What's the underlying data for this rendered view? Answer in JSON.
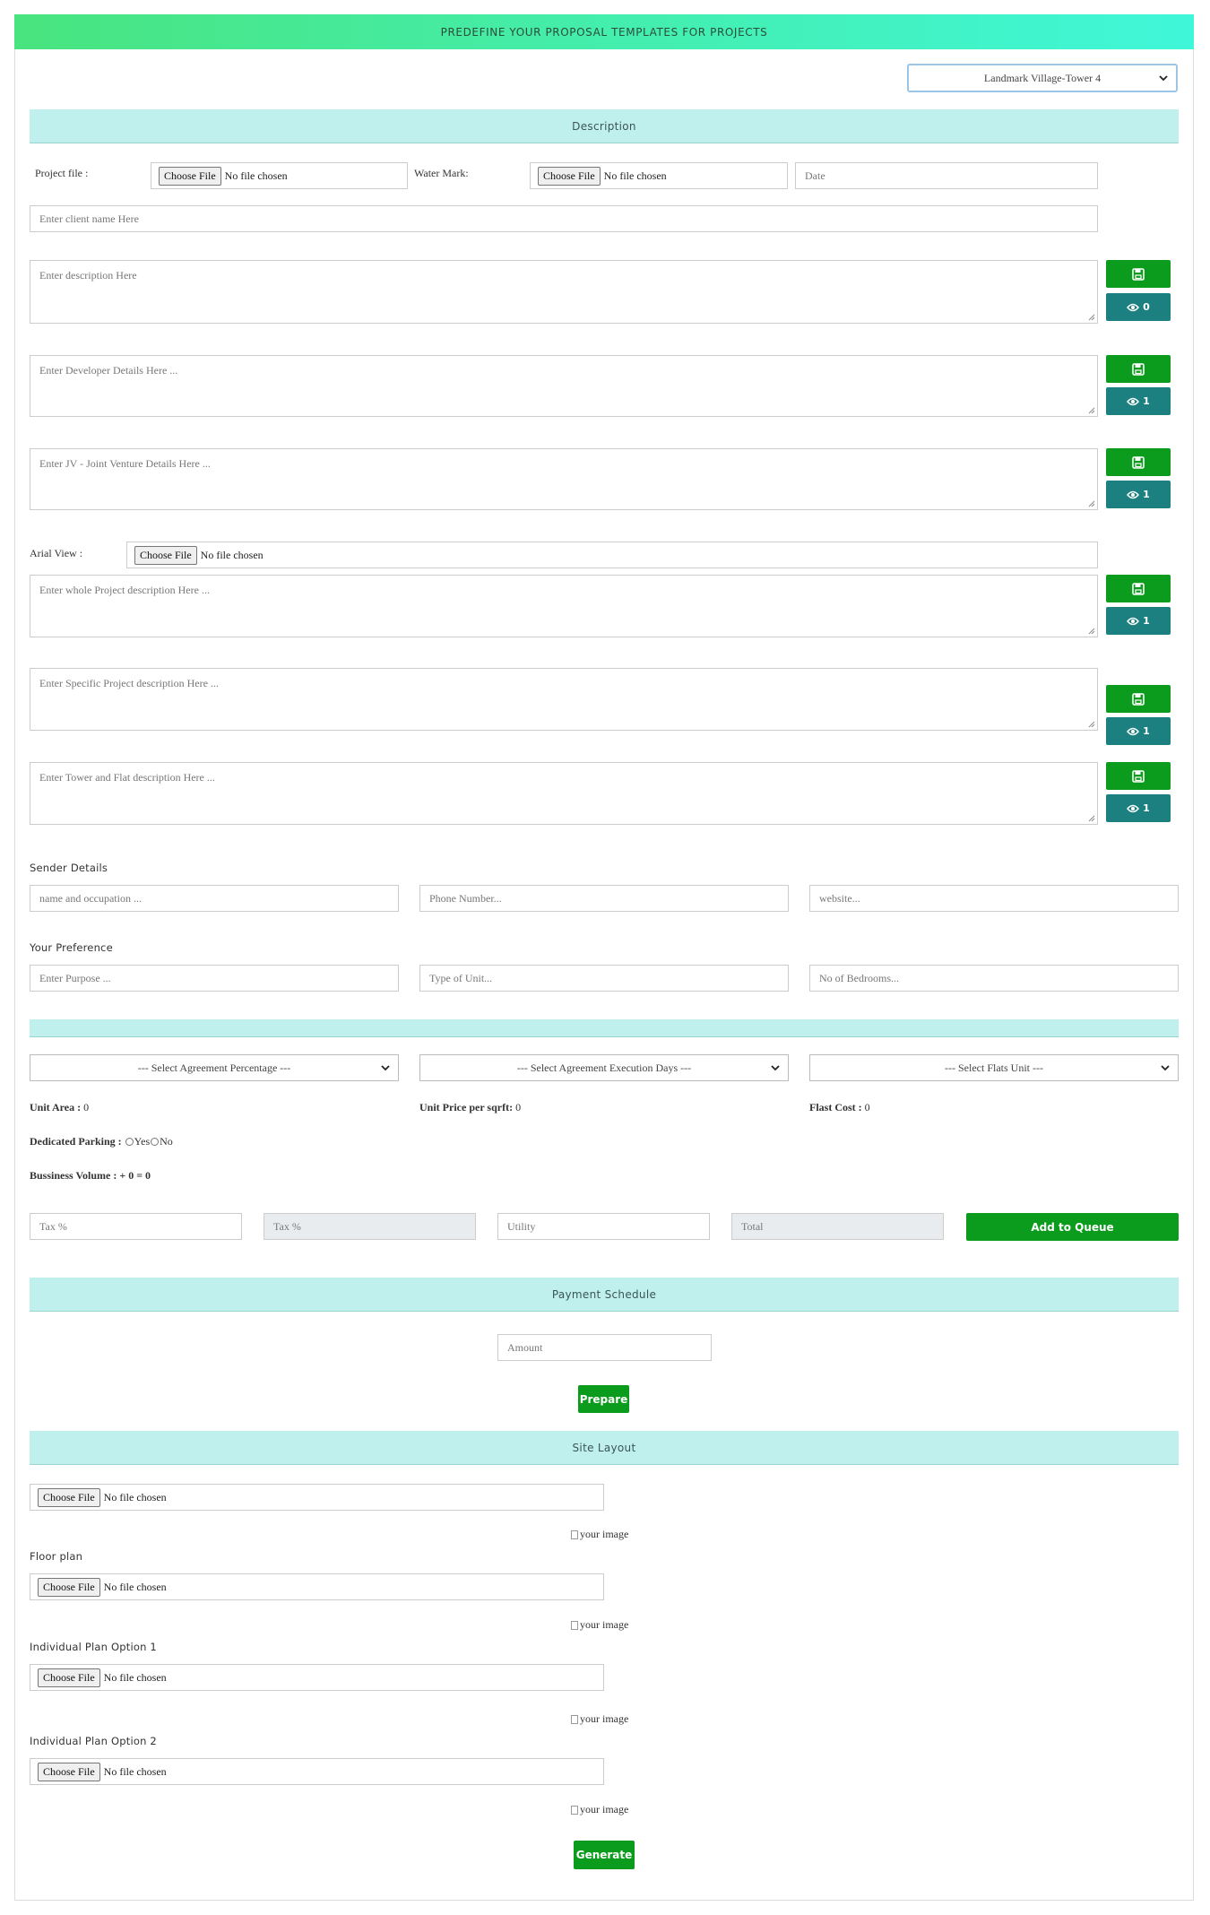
{
  "header": {
    "title": "PREDEFINE YOUR PROPOSAL TEMPLATES FOR PROJECTS"
  },
  "project_select": {
    "value": "Landmark Village-Tower 4"
  },
  "sections": {
    "description": "Description",
    "payment_schedule": "Payment Schedule",
    "site_layout": "Site Layout"
  },
  "file_input": {
    "button": "Choose File",
    "status": "No file chosen"
  },
  "top_row": {
    "project_file_label": "Project file :",
    "water_mark_label": "Water Mark:",
    "date_placeholder": "Date",
    "client_placeholder": "Enter client name Here"
  },
  "text_blocks": [
    {
      "placeholder": "Enter description Here",
      "count": "0"
    },
    {
      "placeholder": "Enter Developer Details Here ...",
      "count": "1"
    },
    {
      "placeholder": "Enter JV - Joint Venture Details Here ...",
      "count": "1"
    },
    {
      "placeholder": "Enter whole Project description Here ...",
      "count": "1"
    },
    {
      "placeholder": "Enter Specific Project description Here ...",
      "count": "1"
    },
    {
      "placeholder": "Enter Tower and Flat description Here ...",
      "count": "1"
    }
  ],
  "arial_view_label": "Arial View :",
  "sender": {
    "heading": "Sender Details",
    "name_placeholder": "name and occupation ...",
    "phone_placeholder": "Phone Number...",
    "website_placeholder": "website..."
  },
  "preference": {
    "heading": "Your Preference",
    "purpose_placeholder": "Enter Purpose ...",
    "unit_placeholder": "Type of Unit...",
    "bedrooms_placeholder": "No of Bedrooms..."
  },
  "agreement": {
    "percentage": "--- Select Agreement Percentage ---",
    "execution_days": "--- Select Agreement Execution Days ---",
    "flats_unit": "--- Select Flats Unit ---"
  },
  "stats": {
    "unit_area_label": "Unit Area :",
    "unit_area_value": "0",
    "unit_price_label": "Unit Price per sqrft:",
    "unit_price_value": "0",
    "flast_cost_label": "Flast Cost :",
    "flast_cost_value": "0",
    "parking_label": "Dedicated Parking :",
    "parking_yes": "Yes",
    "parking_no": "No",
    "volume_label": "Bussiness Volume :",
    "volume_value": "+ 0 = 0"
  },
  "tax_row": {
    "tax_placeholder": "Tax %",
    "tax2_placeholder": "Tax %",
    "utility_placeholder": "Utility",
    "total_placeholder": "Total",
    "add_button": "Add to Queue"
  },
  "payment": {
    "amount_placeholder": "Amount",
    "prepare_button": "Prepare"
  },
  "layout": {
    "image_alt": "your image",
    "floor_plan": "Floor plan",
    "option1": "Individual Plan Option 1",
    "option2": "Individual Plan Option 2",
    "generate_button": "Generate"
  },
  "colors": {
    "save_green": "#0c9c1d",
    "view_teal": "#1b807f",
    "section_bg": "#bff0ee"
  }
}
